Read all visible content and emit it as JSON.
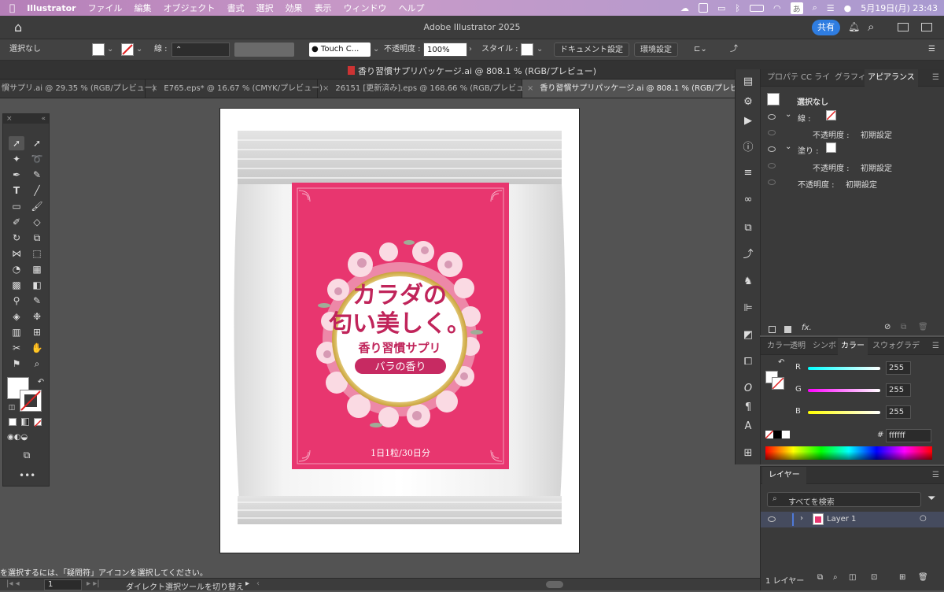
{
  "menubar": {
    "app": "Illustrator",
    "items": [
      "ファイル",
      "編集",
      "オブジェクト",
      "書式",
      "選択",
      "効果",
      "表示",
      "ウィンドウ",
      "ヘルプ"
    ],
    "ime": "あ",
    "datetime": "5月19日(月)  23:43"
  },
  "titlebar": {
    "title": "Adobe Illustrator 2025",
    "share": "共有"
  },
  "control": {
    "selection": "選択なし",
    "stroke_label": "線 :",
    "brush": "Touch C...",
    "opacity_label": "不透明度 :",
    "opacity_value": "100%",
    "style_label": "スタイル :",
    "doc_setup": "ドキュメント設定",
    "prefs": "環境設定"
  },
  "document": {
    "title": "香り習慣サプリパッケージ.ai @ 808.1 % (RGB/プレビュー)"
  },
  "tabs": [
    {
      "label": "慣サプリ.ai @ 29.35 % (RGB/プレビュー)",
      "close": "×"
    },
    {
      "label": "E765.eps* @ 16.67 % (CMYK/プレビュー)",
      "close": "×"
    },
    {
      "label": "26151 [更新済み].eps @ 168.66 % (RGB/プレビュー)",
      "close": "×"
    },
    {
      "label": "香り習慣サプリパッケージ.ai @ 808.1 % (RGB/プレビュー)",
      "close": "×"
    }
  ],
  "artwork": {
    "headline_line1": "カラダの",
    "headline_line2": "匂い美しく。",
    "product": "香り習慣サプリ",
    "flavor": "バラの香り",
    "dosage": "1日1粒/30日分",
    "label_color": "#e8366f",
    "gold": "#d4af37"
  },
  "appearance_panel": {
    "tabs": [
      "プロパテ",
      "CC ライ",
      "グラフィ",
      "アピアランス"
    ],
    "active": "アピアランス",
    "title": "選択なし",
    "stroke_label": "線 :",
    "fill_label": "塗り :",
    "opacity_label": "不透明度 :",
    "default": "初期設定",
    "fx": "fx."
  },
  "color_panel": {
    "tabs": [
      "カラー",
      "透明",
      "シンボ",
      "カラー",
      "スウォ",
      "グラデ"
    ],
    "active_index": 3,
    "r_label": "R",
    "g_label": "G",
    "b_label": "B",
    "r": "255",
    "g": "255",
    "b": "255",
    "hash": "#",
    "hex": "ffffff"
  },
  "layers_panel": {
    "tab": "レイヤー",
    "search_placeholder": "すべてを検索",
    "layer_name": "Layer 1",
    "footer": "1 レイヤー"
  },
  "status": {
    "hint": "を選択するには、「疑問符」アイコンを選択してください。",
    "page": "1",
    "tool_hint": "ダイレクト選択ツールを切り替え"
  }
}
